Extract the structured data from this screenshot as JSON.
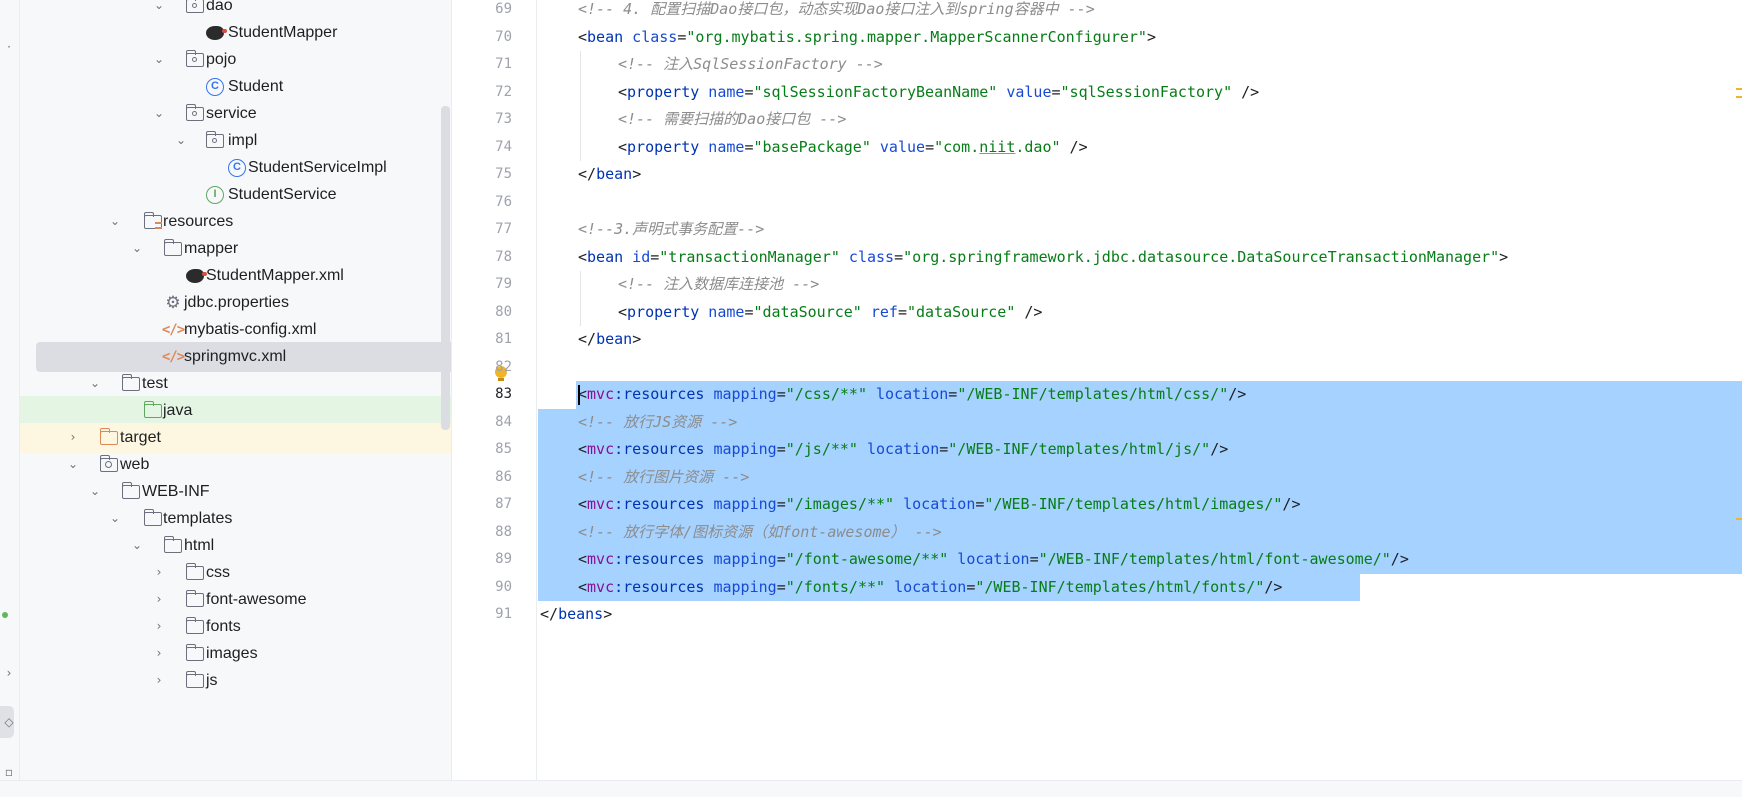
{
  "project_tree": {
    "rows": [
      {
        "label": "dao",
        "icon": "package-folder-icon"
      },
      {
        "label": "StudentMapper",
        "icon": "mybatis-mapper-icon"
      },
      {
        "label": "pojo",
        "icon": "package-folder-icon"
      },
      {
        "label": "Student",
        "icon": "class-icon"
      },
      {
        "label": "service",
        "icon": "package-folder-icon"
      },
      {
        "label": "impl",
        "icon": "package-folder-icon"
      },
      {
        "label": "StudentServiceImpl",
        "icon": "class-icon"
      },
      {
        "label": "StudentService",
        "icon": "interface-icon"
      },
      {
        "label": "resources",
        "icon": "resources-folder-icon"
      },
      {
        "label": "mapper",
        "icon": "folder-icon"
      },
      {
        "label": "StudentMapper.xml",
        "icon": "mybatis-xml-icon"
      },
      {
        "label": "jdbc.properties",
        "icon": "properties-gear-icon"
      },
      {
        "label": "mybatis-config.xml",
        "icon": "xml-file-icon"
      },
      {
        "label": "springmvc.xml",
        "icon": "spring-xml-icon"
      },
      {
        "label": "test",
        "icon": "folder-icon"
      },
      {
        "label": "java",
        "icon": "test-source-folder-icon"
      },
      {
        "label": "target",
        "icon": "excluded-folder-icon"
      },
      {
        "label": "web",
        "icon": "web-folder-icon"
      },
      {
        "label": "WEB-INF",
        "icon": "folder-icon"
      },
      {
        "label": "templates",
        "icon": "folder-icon"
      },
      {
        "label": "html",
        "icon": "folder-icon"
      },
      {
        "label": "css",
        "icon": "folder-icon"
      },
      {
        "label": "font-awesome",
        "icon": "folder-icon"
      },
      {
        "label": "fonts",
        "icon": "folder-icon"
      },
      {
        "label": "images",
        "icon": "folder-icon"
      },
      {
        "label": "js",
        "icon": "folder-icon"
      }
    ],
    "selected": "springmvc.xml"
  },
  "editor": {
    "current_line": "83",
    "lines": [
      {
        "n": "69",
        "code": "<!-- 4. 配置扫描Dao接口包，动态实现Dao接口注入到spring容器中 -->"
      },
      {
        "n": "70",
        "code": "<bean class=\"org.mybatis.spring.mapper.MapperScannerConfigurer\">"
      },
      {
        "n": "71",
        "code": "<!-- 注入SqlSessionFactory -->"
      },
      {
        "n": "72",
        "code": "<property name=\"sqlSessionFactoryBeanName\" value=\"sqlSessionFactory\" />"
      },
      {
        "n": "73",
        "code": "<!-- 需要扫描的Dao接口包 -->"
      },
      {
        "n": "74",
        "code": "<property name=\"basePackage\" value=\"com.niit.dao\" />"
      },
      {
        "n": "75",
        "code": "</bean>"
      },
      {
        "n": "76",
        "code": ""
      },
      {
        "n": "77",
        "code": "<!--3.声明式事务配置-->"
      },
      {
        "n": "78",
        "code": "<bean id=\"transactionManager\" class=\"org.springframework.jdbc.datasource.DataSourceTransactionManager\">"
      },
      {
        "n": "79",
        "code": "<!-- 注入数据库连接池 -->"
      },
      {
        "n": "80",
        "code": "<property name=\"dataSource\" ref=\"dataSource\" />"
      },
      {
        "n": "81",
        "code": "</bean>"
      },
      {
        "n": "82",
        "code": ""
      },
      {
        "n": "83",
        "code": "<mvc:resources mapping=\"/css/**\" location=\"/WEB-INF/templates/html/css/\"/>"
      },
      {
        "n": "84",
        "code": "<!-- 放行JS资源 -->"
      },
      {
        "n": "85",
        "code": "<mvc:resources mapping=\"/js/**\" location=\"/WEB-INF/templates/html/js/\"/>"
      },
      {
        "n": "86",
        "code": "<!-- 放行图片资源 -->"
      },
      {
        "n": "87",
        "code": "<mvc:resources mapping=\"/images/**\" location=\"/WEB-INF/templates/html/images/\"/>"
      },
      {
        "n": "88",
        "code": "<!-- 放行字体/图标资源（如font-awesome） -->"
      },
      {
        "n": "89",
        "code": "<mvc:resources mapping=\"/font-awesome/**\" location=\"/WEB-INF/templates/html/font-awesome/\"/>"
      },
      {
        "n": "90",
        "code": "<mvc:resources mapping=\"/fonts/**\" location=\"/WEB-INF/templates/html/fonts/\"/>"
      },
      {
        "n": "91",
        "code": "</beans>"
      }
    ]
  },
  "colors": {
    "selection": "#a6d2ff",
    "comment": "#8c8c8c",
    "tag": "#0033b3",
    "attribute": "#174ad4",
    "string": "#067d17",
    "namespace": "#871094"
  }
}
